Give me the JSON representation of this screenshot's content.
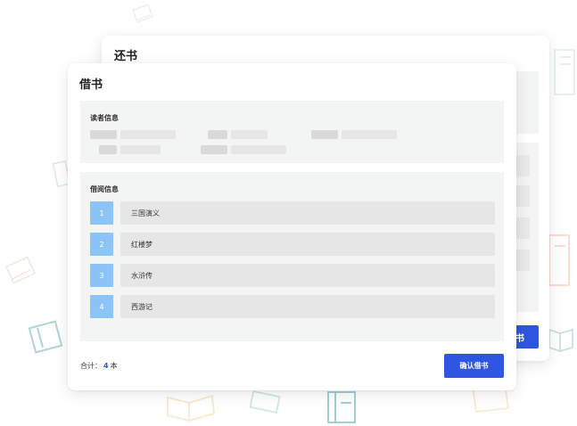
{
  "back_panel": {
    "title": "还书",
    "button_label": "书"
  },
  "borrow_panel": {
    "title": "借书",
    "reader_section_label": "读者信息",
    "borrow_section_label": "借阅信息",
    "books": [
      {
        "index": "1",
        "name": "三国演义"
      },
      {
        "index": "2",
        "name": "红楼梦"
      },
      {
        "index": "3",
        "name": "水浒传"
      },
      {
        "index": "4",
        "name": "西游记"
      }
    ],
    "total_label": "合计：",
    "total_count": "4",
    "total_unit": "本",
    "confirm_label": "确认借书"
  },
  "colors": {
    "accent": "#2f56e0",
    "index_badge": "#8cc4f8",
    "section_bg": "#f3f4f4",
    "placeholder": "#e6e6e6"
  },
  "icons": [
    "book-doodle-icon",
    "open-book-icon",
    "book-stack-icon"
  ]
}
